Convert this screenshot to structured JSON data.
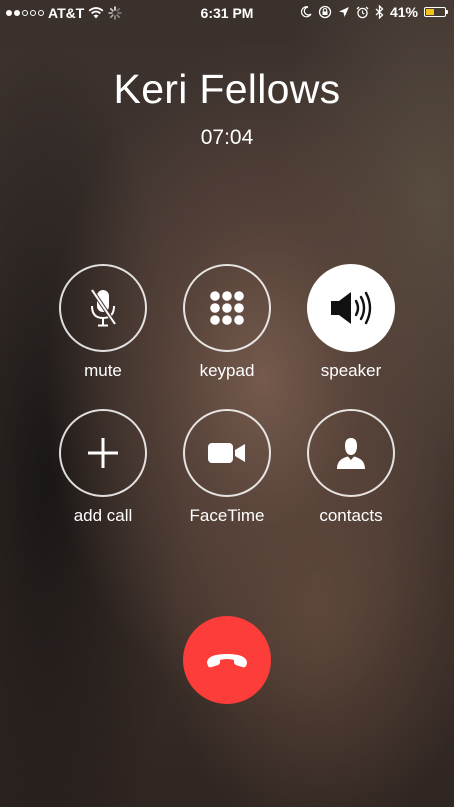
{
  "status_bar": {
    "carrier": "AT&T",
    "time": "6:31 PM",
    "battery": "41%",
    "battery_level": 0.41,
    "signal_bars_filled": 2,
    "signal_bars_total": 5,
    "icons": [
      "wifi-icon",
      "activity-spinner-icon",
      "moon-icon",
      "rotation-lock-icon",
      "location-icon",
      "alarm-icon",
      "bluetooth-icon",
      "battery-icon"
    ],
    "battery_color": "#f2c419"
  },
  "call": {
    "name": "Keri Fellows",
    "duration": "07:04"
  },
  "controls": {
    "mute": "mute",
    "keypad": "keypad",
    "speaker": "speaker",
    "add_call": "add call",
    "facetime": "FaceTime",
    "contacts": "contacts"
  },
  "end_call": {
    "icon": "end-call-icon",
    "color": "#fc3d39"
  }
}
